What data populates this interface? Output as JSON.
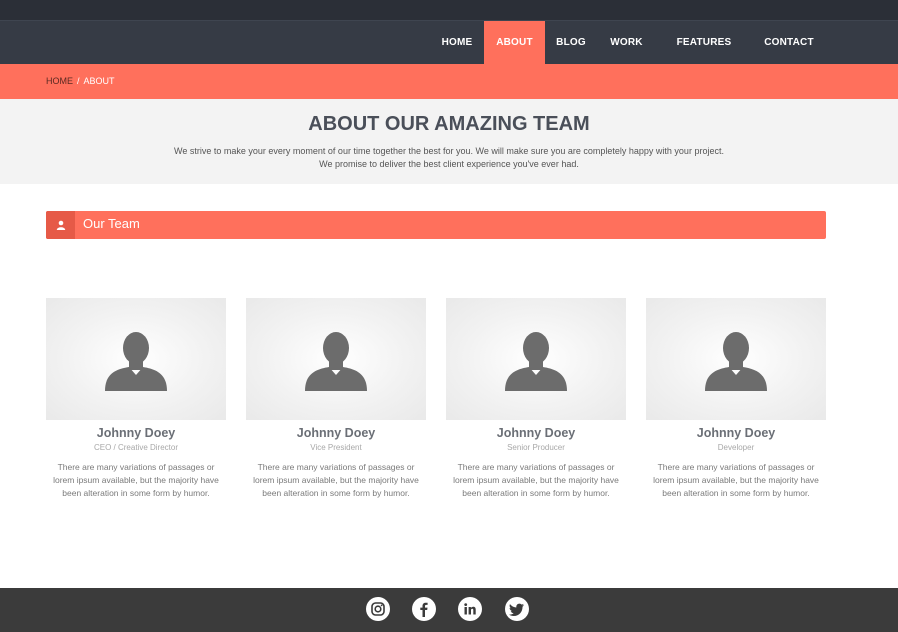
{
  "nav": {
    "items": [
      "HOME",
      "ABOUT",
      "BLOG",
      "WORK",
      "FEATURES",
      "CONTACT"
    ],
    "active": "ABOUT"
  },
  "breadcrumb": {
    "home": "HOME",
    "separator": "/",
    "current": "ABOUT"
  },
  "hero": {
    "title": "ABOUT OUR AMAZING TEAM",
    "line1": "We strive to make your every moment of our time together the best for you. We will make sure you are completely happy with your project.",
    "line2": "We promise to deliver the best client experience you've ever had."
  },
  "section": {
    "title": "Our Team",
    "icon": "user-icon"
  },
  "team": [
    {
      "name": "Johnny Doey",
      "role": "CEO  /  Creative Director",
      "desc": "There are many variations of passages or lorem ipsum available, but the majority have been alteration in some form by humor."
    },
    {
      "name": "Johnny Doey",
      "role": "Vice President",
      "desc": "There are many variations of passages or lorem ipsum available, but the majority have been alteration in some form by humor."
    },
    {
      "name": "Johnny Doey",
      "role": "Senior Producer",
      "desc": "There are many variations of passages or lorem ipsum available, but the majority have been alteration in some form by humor."
    },
    {
      "name": "Johnny Doey",
      "role": "Developer",
      "desc": "There are many variations of passages or lorem ipsum available, but the majority have been alteration in some form by humor."
    }
  ],
  "footer": {
    "social": [
      "instagram-icon",
      "facebook-icon",
      "linkedin-icon",
      "twitter-icon"
    ]
  },
  "colors": {
    "accent": "#ff705c",
    "nav_bg": "#363b45",
    "top_bg": "#2b2f37",
    "footer_bg": "#3b3b3b"
  }
}
